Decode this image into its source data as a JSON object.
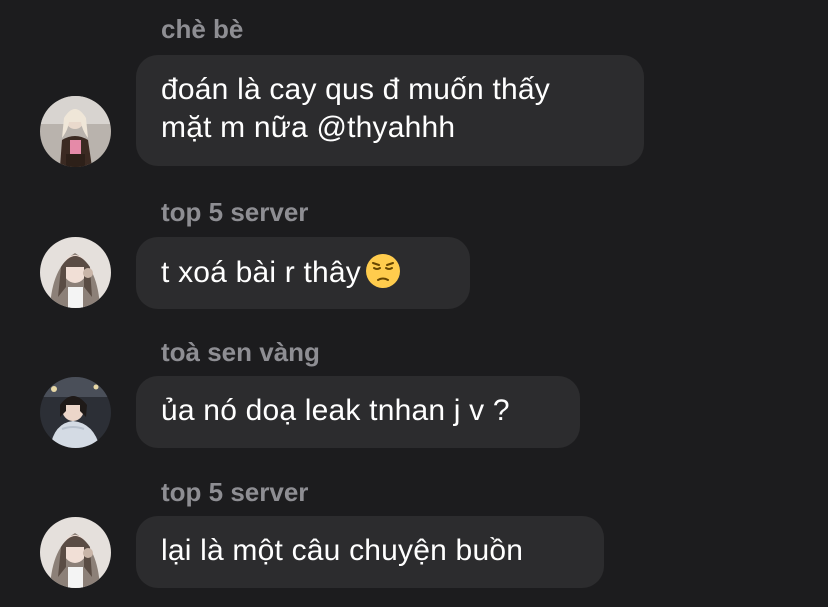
{
  "messages": [
    {
      "sender": "chè bè",
      "text_lines": [
        "đoán là cay qus đ muốn thấy",
        "mặt m nữa @thyahhh"
      ],
      "emoji": null
    },
    {
      "sender": "top 5 server",
      "text_lines": [
        "t xoá bài r thây"
      ],
      "emoji": "pensive-face"
    },
    {
      "sender": "toà sen vàng",
      "text_lines": [
        "ủa nó doạ leak tnhan j v ?"
      ],
      "emoji": null
    },
    {
      "sender": "top 5 server",
      "text_lines": [
        "lại là một câu chuyện buồn"
      ],
      "emoji": null
    }
  ],
  "colors": {
    "background": "#1c1c1e",
    "bubble": "#2c2c2e",
    "sender_text": "#8e8e93",
    "message_text": "#ffffff"
  }
}
